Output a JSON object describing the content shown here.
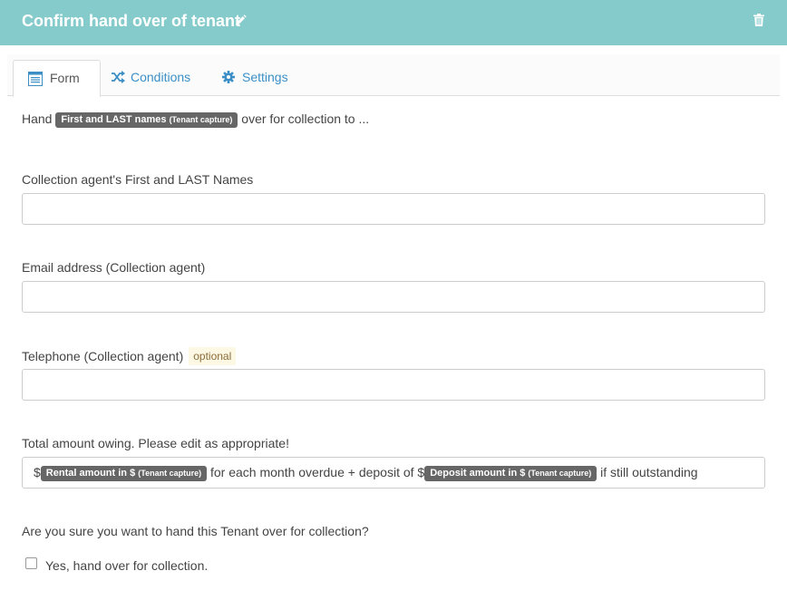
{
  "header": {
    "title": "Confirm hand over of tenant",
    "edit_icon": "pencil-icon",
    "delete_icon": "trash-icon",
    "background_color": "#86cbcb"
  },
  "tabs": [
    {
      "label": "Form",
      "icon": "form-icon",
      "active": true
    },
    {
      "label": "Conditions",
      "icon": "shuffle-icon",
      "active": false
    },
    {
      "label": "Settings",
      "icon": "gear-icon",
      "active": false
    }
  ],
  "intro": {
    "before": "Hand",
    "tag_main": "First and LAST names",
    "tag_source": "(Tenant capture)",
    "after": "over for collection to ..."
  },
  "fields": {
    "agent_name": {
      "label": "Collection agent's First and LAST Names",
      "value": ""
    },
    "email": {
      "label": "Email address (Collection agent)",
      "value": ""
    },
    "telephone": {
      "label": "Telephone (Collection agent)",
      "badge": "optional",
      "value": ""
    },
    "amount": {
      "label": "Total amount owing. Please edit as appropriate!",
      "prefix": "$",
      "tag1_main": "Rental amount in $",
      "tag1_source": "(Tenant capture)",
      "middle": "for each month overdue + deposit of $",
      "tag2_main": "Deposit amount in $",
      "tag2_source": "(Tenant capture)",
      "suffix": "if still outstanding"
    }
  },
  "confirm": {
    "question": "Are you sure you want to hand this Tenant over for collection?",
    "checkbox_label": "Yes, hand over for collection.",
    "checked": false
  }
}
